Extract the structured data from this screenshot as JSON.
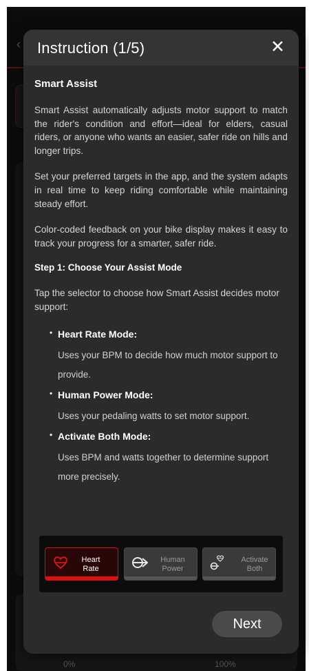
{
  "background": {
    "back_icon": "chevron-left-icon",
    "pct_start": "0%",
    "pct_end": "100%"
  },
  "modal": {
    "title": "Instruction (1/5)",
    "close_icon": "close-icon",
    "close_label": "✕",
    "section_title": "Smart Assist",
    "paragraphs": [
      "Smart Assist automatically adjusts motor support to match the rider's condition and effort—ideal for elders, casual riders, or anyone who wants an easier, safer ride on hills and longer trips.",
      "Set your preferred targets in the app, and the system adapts in real time to keep riding comfortable while maintaining steady effort.",
      "Color-coded feedback on your bike display makes it easy to track your progress for a smarter, safer ride."
    ],
    "step_title": "Step 1: Choose Your Assist Mode",
    "step_intro": "Tap the selector to choose how Smart Assist decides motor support:",
    "modes": [
      {
        "name": "Heart Rate Mode:",
        "desc": "Uses your BPM to decide how much motor support to provide."
      },
      {
        "name": "Human Power Mode:",
        "desc": "Uses your pedaling watts to set motor support."
      },
      {
        "name": "Activate Both Mode:",
        "desc": "Uses BPM and watts together to determine support more precisely."
      }
    ],
    "selector": {
      "heart_rate": {
        "line1": "Heart",
        "line2": "Rate",
        "icon": "heart-icon",
        "selected": true
      },
      "human_power": {
        "line1": "Human",
        "line2": "Power",
        "icon": "pedal-power-icon",
        "selected": false
      },
      "activate_both": {
        "line1": "Activate",
        "line2": "Both",
        "icon": "heart-and-power-icon",
        "selected": false
      }
    },
    "next_label": "Next"
  },
  "colors": {
    "accent": "#e01010",
    "modal_bg": "#2b2b2b",
    "header_bg": "#343434",
    "button_bg": "#4a4a4a"
  }
}
